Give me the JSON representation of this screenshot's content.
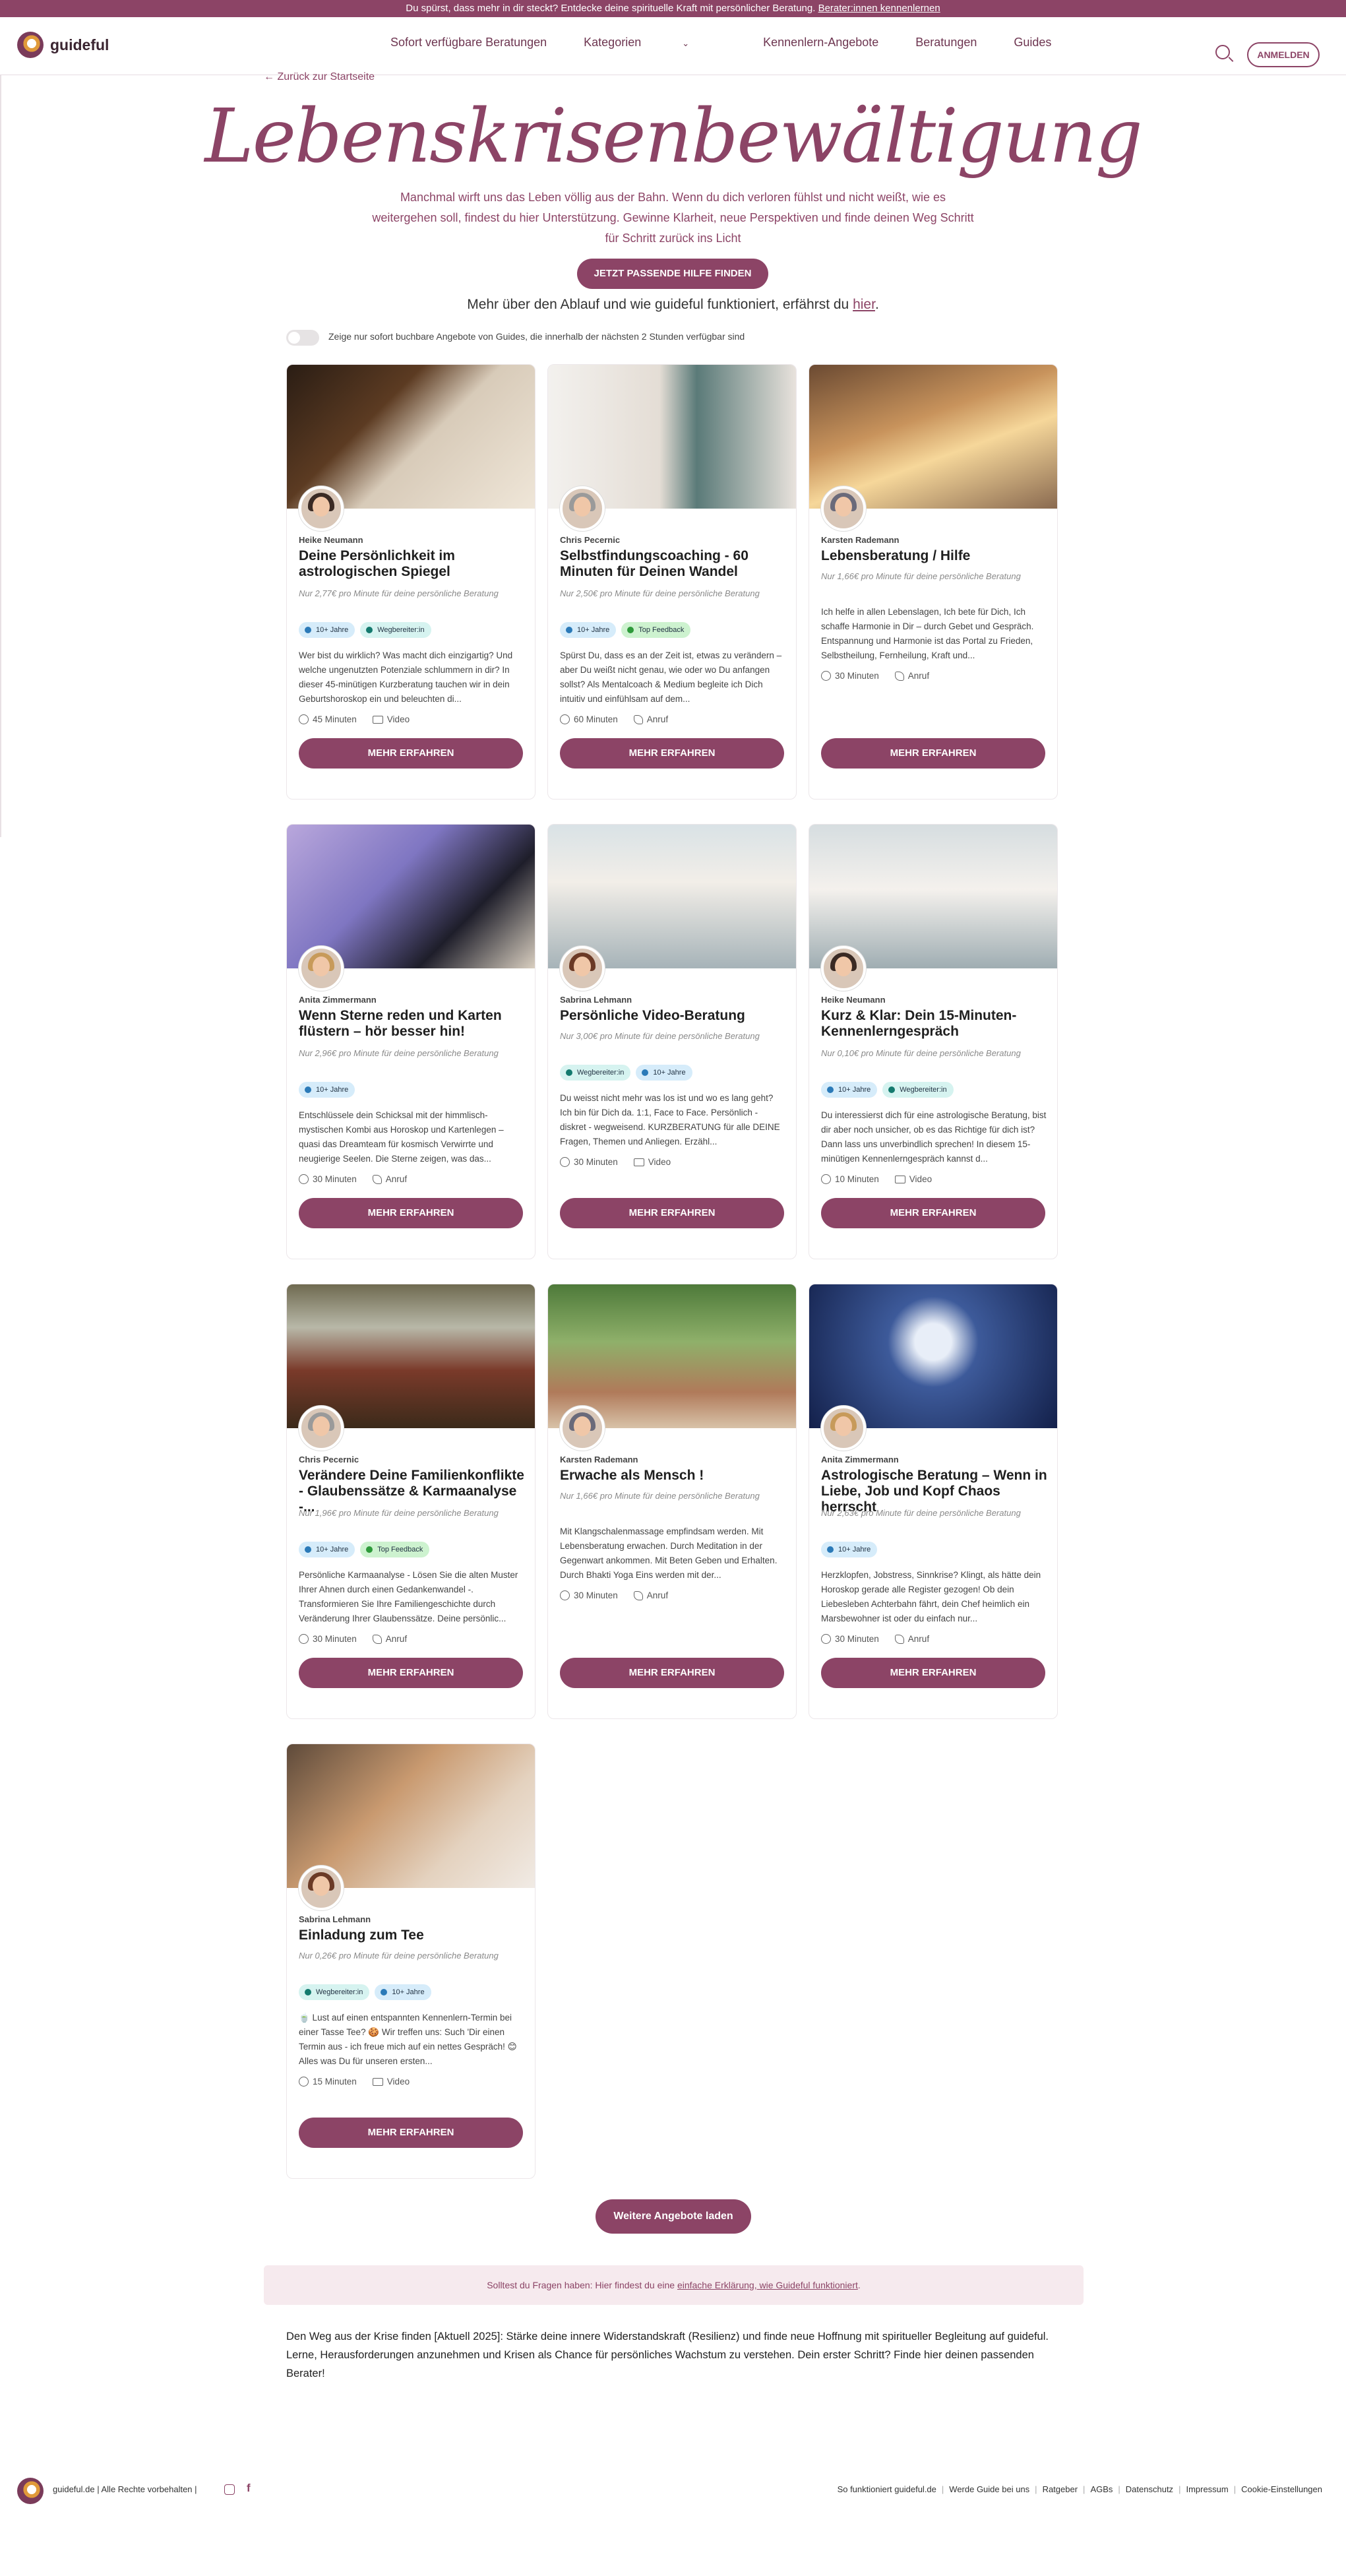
{
  "banner": {
    "text": "Du spürst, dass mehr in dir steckt? Entdecke deine spirituelle Kraft mit persönlicher Beratung.",
    "link": "Berater:innen kennenlernen"
  },
  "nav": {
    "brand": "guideful",
    "items": [
      "Sofort verfügbare Beratungen",
      "Kategorien",
      "Kennenlern-Angebote",
      "Beratungen",
      "Guides"
    ],
    "login": "ANMELDEN"
  },
  "back_link": "Zurück zur Startseite",
  "hero": {
    "title": "Lebenskrisenbewältigung",
    "text": "Manchmal wirft uns das Leben völlig aus der Bahn. Wenn du dich verloren fühlst und nicht weißt, wie es weitergehen soll, findest du hier Unterstützung. Gewinne Klarheit, neue Perspektiven und finde deinen Weg Schritt für Schritt zurück ins Licht",
    "cta": "JETZT PASSENDE HILFE FINDEN",
    "more_text": "Mehr über den Ablauf und wie guideful funktioniert, erfährst du",
    "more_link": "hier",
    "toggle_label": "Zeige nur sofort buchbare Angebote von Guides, die innerhalb der nächsten 2 Stunden verfügbar sind"
  },
  "cards": [
    {
      "name": "Heike Neumann",
      "title": "Deine Persönlichkeit im astrologischen Spiegel",
      "price": "Nur 2,77€ pro Minute für deine persönliche Beratung",
      "badges": [
        "10+ Jahre",
        "Wegbereiter:in"
      ],
      "desc": "Wer bist du wirklich? Was macht dich einzigartig? Und welche ungenutzten Potenziale schlummern in dir? In dieser 45-minütigen Kurzberatung tauchen wir in dein Geburtshoroskop ein und beleuchten di...",
      "duration": "45 Minuten",
      "mode": "Video",
      "button": "MEHR ERFAHREN"
    },
    {
      "name": "Chris Pecernic",
      "title": "Selbstfindungscoaching - 60 Minuten für Deinen Wandel",
      "price": "Nur 2,50€ pro Minute für deine persönliche Beratung",
      "badges": [
        "10+ Jahre",
        "Top Feedback"
      ],
      "desc": "Spürst Du, dass es an der Zeit ist, etwas zu verändern – aber Du weißt nicht genau, wie oder wo Du anfangen sollst? Als Mentalcoach & Medium begleite ich Dich intuitiv und einfühlsam auf dem...",
      "duration": "60 Minuten",
      "mode": "Anruf",
      "button": "MEHR ERFAHREN"
    },
    {
      "name": "Karsten Rademann",
      "title": "Lebensberatung / Hilfe",
      "price": "Nur 1,66€ pro Minute für deine persönliche Beratung",
      "badges": [],
      "desc": "Ich helfe in allen Lebenslagen, Ich bete für Dich, Ich schaffe Harmonie in Dir – durch Gebet und Gespräch. Entspannung und Harmonie ist das Portal zu Frieden, Selbstheilung, Fernheilung, Kraft und...",
      "duration": "30 Minuten",
      "mode": "Anruf",
      "button": "MEHR ERFAHREN"
    },
    {
      "name": "Anita Zimmermann",
      "title": "Wenn Sterne reden und Karten flüstern – hör besser hin!",
      "price": "Nur 2,96€ pro Minute für deine persönliche Beratung",
      "badges": [
        "10+ Jahre"
      ],
      "desc": "Entschlüssele dein Schicksal mit der himmlisch-mystischen Kombi aus Horoskop und Kartenlegen – quasi das Dreamteam für kosmisch Verwirrte und neugierige Seelen. Die Sterne zeigen, was das...",
      "duration": "30 Minuten",
      "mode": "Anruf",
      "button": "MEHR ERFAHREN"
    },
    {
      "name": "Sabrina Lehmann",
      "title": "Persönliche Video-Beratung",
      "price": "Nur 3,00€ pro Minute für deine persönliche Beratung",
      "badges": [
        "Wegbereiter:in",
        "10+ Jahre"
      ],
      "desc": "Du weisst nicht mehr was los ist und wo es lang geht? Ich bin für Dich da. 1:1, Face to Face. Persönlich - diskret - wegweisend. KURZBERATUNG für alle DEINE Fragen, Themen und Anliegen. Erzähl...",
      "duration": "30 Minuten",
      "mode": "Video",
      "button": "MEHR ERFAHREN"
    },
    {
      "name": "Heike Neumann",
      "title": "Kurz & Klar: Dein 15-Minuten-Kennenlerngespräch",
      "price": "Nur 0,10€ pro Minute für deine persönliche Beratung",
      "badges": [
        "10+ Jahre",
        "Wegbereiter:in"
      ],
      "desc": "Du interessierst dich für eine astrologische Beratung, bist dir aber noch unsicher, ob es das Richtige für dich ist? Dann lass uns unverbindlich sprechen! In diesem 15-minütigen Kennenlerngespräch kannst d...",
      "duration": "10 Minuten",
      "mode": "Video",
      "button": "MEHR ERFAHREN"
    },
    {
      "name": "Chris Pecernic",
      "title": "Verändere Deine Familienkonflikte - Glaubenssätze & Karmaanalyse -...",
      "price": "Nur 1,96€ pro Minute für deine persönliche Beratung",
      "badges": [
        "10+ Jahre",
        "Top Feedback"
      ],
      "desc": "Persönliche Karmaanalyse - Lösen Sie die alten Muster Ihrer Ahnen durch einen Gedankenwandel -. Transformieren Sie Ihre Familiengeschichte durch Veränderung Ihrer Glaubenssätze. Deine persönlic...",
      "duration": "30 Minuten",
      "mode": "Anruf",
      "button": "MEHR ERFAHREN"
    },
    {
      "name": "Karsten Rademann",
      "title": "Erwache als Mensch !",
      "price": "Nur 1,66€ pro Minute für deine persönliche Beratung",
      "badges": [],
      "desc": "Mit Klangschalenmassage empfindsam werden. Mit Lebensberatung erwachen. Durch Meditation in der Gegenwart ankommen. Mit Beten Geben und Erhalten. Durch Bhakti Yoga Eins werden mit der...",
      "duration": "30 Minuten",
      "mode": "Anruf",
      "button": "MEHR ERFAHREN"
    },
    {
      "name": "Anita Zimmermann",
      "title": "Astrologische Beratung – Wenn in Liebe, Job und Kopf Chaos herrscht",
      "price": "Nur 2,63€ pro Minute für deine persönliche Beratung",
      "badges": [
        "10+ Jahre"
      ],
      "desc": "Herzklopfen, Jobstress, Sinnkrise? Klingt, als hätte dein Horoskop gerade alle Register gezogen! Ob dein Liebesleben Achterbahn fährt, dein Chef heimlich ein Marsbewohner ist oder du einfach nur...",
      "duration": "30 Minuten",
      "mode": "Anruf",
      "button": "MEHR ERFAHREN"
    },
    {
      "name": "Sabrina Lehmann",
      "title": "Einladung zum Tee",
      "price": "Nur 0,26€ pro Minute für deine persönliche Beratung",
      "badges": [
        "Wegbereiter:in",
        "10+ Jahre"
      ],
      "desc": "🍵 Lust auf einen entspannten Kennenlern-Termin bei einer Tasse Tee? 🍪 Wir treffen uns: Such 'Dir einen Termin aus - ich freue mich auf ein nettes Gespräch! 😊 Alles was Du für unseren ersten...",
      "duration": "15 Minuten",
      "mode": "Video",
      "button": "MEHR ERFAHREN"
    }
  ],
  "load_more": "Weitere Angebote laden",
  "faq": {
    "text": "Solltest du Fragen haben: Hier findest du eine",
    "link": "einfache Erklärung, wie Guideful funktioniert",
    "end": "."
  },
  "seo_text": "Den Weg aus der Krise finden [Aktuell 2025]: Stärke deine innere Widerstandskraft (Resilienz) und finde neue Hoffnung mit spiritueller Begleitung auf guideful. Lerne, Herausforderungen anzunehmen und Krisen als Chance für persönliches Wachstum zu verstehen. Dein erster Schritt? Finde hier deinen passenden Berater!",
  "footer": {
    "copy": "guideful.de | Alle Rechte vorbehalten |",
    "links": [
      "So funktioniert guideful.de",
      "Werde Guide bei uns",
      "Ratgeber",
      "AGBs",
      "Datenschutz",
      "Impressum",
      "Cookie-Einstellungen"
    ]
  }
}
